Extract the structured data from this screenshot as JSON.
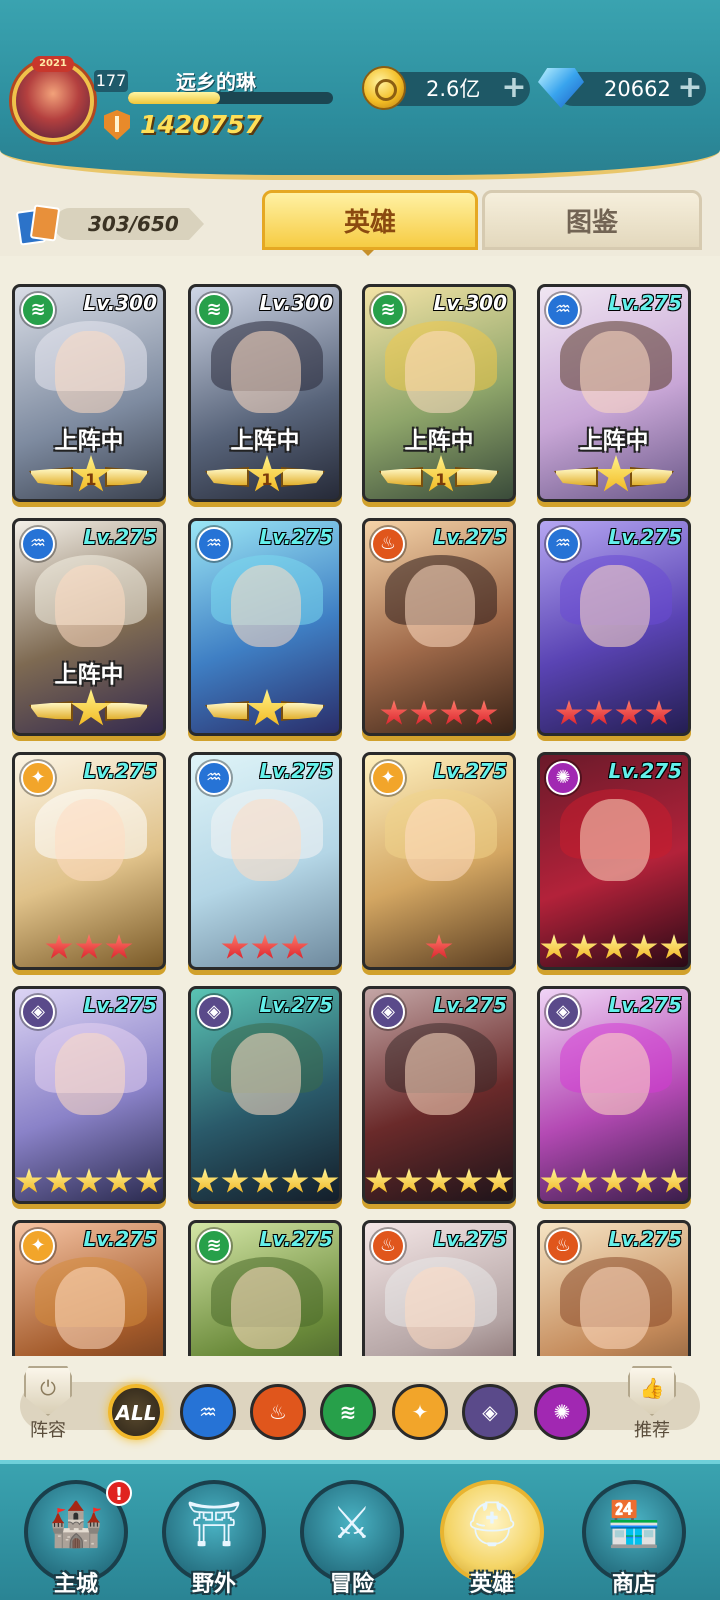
{
  "player": {
    "level": "177",
    "name": "远乡的琳",
    "exp_fraction": 0.45,
    "power": "1420757",
    "avatar_badge": "2021"
  },
  "resources": {
    "gold": "2.6亿",
    "gems": "20662"
  },
  "collection": {
    "count": "303/650"
  },
  "tabs": {
    "heroes": "英雄",
    "codex": "图鉴"
  },
  "deploy_label": "上阵中",
  "heroes": [
    {
      "level": "Lv.300",
      "element": "wind",
      "deployed": true,
      "star_type": "winged",
      "star_number": "1"
    },
    {
      "level": "Lv.300",
      "element": "wind",
      "deployed": true,
      "star_type": "winged",
      "star_number": "1"
    },
    {
      "level": "Lv.300",
      "element": "wind",
      "deployed": true,
      "star_type": "winged",
      "star_number": "1"
    },
    {
      "level": "Lv.275",
      "element": "water",
      "deployed": true,
      "star_type": "winged",
      "star_number": ""
    },
    {
      "level": "Lv.275",
      "element": "water",
      "deployed": true,
      "star_type": "winged",
      "star_number": ""
    },
    {
      "level": "Lv.275",
      "element": "water",
      "deployed": false,
      "star_type": "winged",
      "star_number": ""
    },
    {
      "level": "Lv.275",
      "element": "fire",
      "deployed": false,
      "star_type": "red",
      "stars": 4
    },
    {
      "level": "Lv.275",
      "element": "water",
      "deployed": false,
      "star_type": "red",
      "stars": 4
    },
    {
      "level": "Lv.275",
      "element": "light",
      "deployed": false,
      "star_type": "red",
      "stars": 3
    },
    {
      "level": "Lv.275",
      "element": "water",
      "deployed": false,
      "star_type": "red",
      "stars": 3
    },
    {
      "level": "Lv.275",
      "element": "light",
      "deployed": false,
      "star_type": "red",
      "stars": 1
    },
    {
      "level": "Lv.275",
      "element": "void",
      "deployed": false,
      "star_type": "gold",
      "stars": 5
    },
    {
      "level": "Lv.275",
      "element": "dark",
      "deployed": false,
      "star_type": "gold",
      "stars": 5
    },
    {
      "level": "Lv.275",
      "element": "dark",
      "deployed": false,
      "star_type": "gold",
      "stars": 5
    },
    {
      "level": "Lv.275",
      "element": "dark",
      "deployed": false,
      "star_type": "gold",
      "stars": 5
    },
    {
      "level": "Lv.275",
      "element": "dark",
      "deployed": false,
      "star_type": "gold",
      "stars": 5
    },
    {
      "level": "Lv.275",
      "element": "light",
      "deployed": false,
      "star_type": "none",
      "stars": 0
    },
    {
      "level": "Lv.275",
      "element": "wind",
      "deployed": false,
      "star_type": "none",
      "stars": 0
    },
    {
      "level": "Lv.275",
      "element": "fire",
      "deployed": false,
      "star_type": "none",
      "stars": 0
    },
    {
      "level": "Lv.275",
      "element": "fire",
      "deployed": false,
      "star_type": "none",
      "stars": 0
    }
  ],
  "filters": {
    "lineup_label": "阵容",
    "recommend_label": "推荐",
    "all_label": "ALL",
    "elements": [
      "water",
      "fire",
      "wind",
      "light",
      "dark",
      "void"
    ]
  },
  "nav": [
    {
      "label": "主城",
      "icon": "castle-icon",
      "alert": "!"
    },
    {
      "label": "野外",
      "icon": "portal-icon"
    },
    {
      "label": "冒险",
      "icon": "sword-icon"
    },
    {
      "label": "英雄",
      "icon": "helmet-icon",
      "active": true
    },
    {
      "label": "商店",
      "icon": "shop-icon"
    }
  ],
  "colors": {
    "header": "#2c8c9c",
    "gold_accent": "#f6cc43",
    "wind": "#27a04a",
    "water": "#2673d6",
    "fire": "#e0561c",
    "light": "#f2a52a",
    "dark": "#5a4a8a",
    "void": "#a128b2"
  }
}
